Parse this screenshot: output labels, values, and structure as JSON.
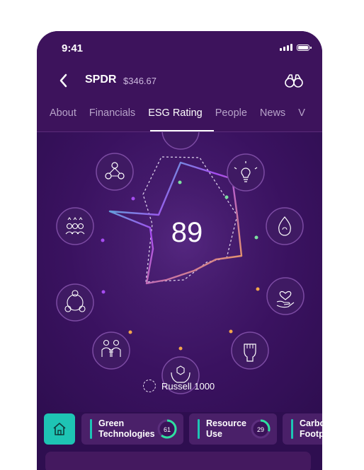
{
  "status": {
    "time": "9:41"
  },
  "header": {
    "ticker": "SPDR",
    "price": "$346.67"
  },
  "tabs": [
    {
      "label": "About"
    },
    {
      "label": "Financials"
    },
    {
      "label": "ESG Rating",
      "active": true
    },
    {
      "label": "People"
    },
    {
      "label": "News"
    },
    {
      "label": "V"
    }
  ],
  "score": {
    "value": "89"
  },
  "legend": {
    "benchmark": "Russell 1000"
  },
  "categories": [
    {
      "name": "Green Technologies",
      "line1": "Green",
      "line2": "Technologies",
      "score": "61"
    },
    {
      "name": "Resource Use",
      "line1": "Resource",
      "line2": "Use",
      "score": "29"
    },
    {
      "name": "Carbon Footprint",
      "line1": "Carbo",
      "line2": "Footpr"
    }
  ],
  "colors": {
    "accent": "#1ec4b4",
    "grad_teal": "#2ee0c8",
    "grad_purple": "#a64cf0",
    "grad_orange": "#f3a54b",
    "bg": "#3a1259"
  }
}
